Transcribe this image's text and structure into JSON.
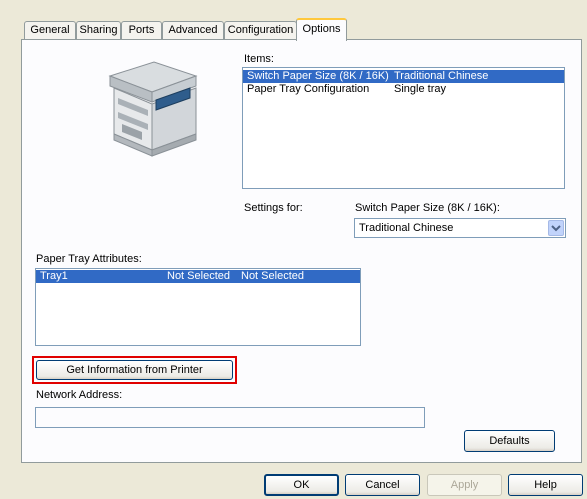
{
  "tabs": [
    "General",
    "Sharing",
    "Ports",
    "Advanced",
    "Configuration",
    "Options"
  ],
  "active_tab": "Options",
  "items": {
    "label": "Items:",
    "rows": [
      {
        "name": "Switch Paper Size (8K / 16K)",
        "value": "Traditional Chinese",
        "selected": true
      },
      {
        "name": "Paper Tray Configuration",
        "value": "Single tray",
        "selected": false
      }
    ]
  },
  "settings_for": {
    "label": "Settings for:",
    "setting_name": "Switch Paper Size (8K / 16K):",
    "selected_value": "Traditional Chinese"
  },
  "paper_tray": {
    "label": "Paper Tray Attributes:",
    "rows": [
      {
        "name": "Tray1",
        "col1": "Not Selected",
        "col2": "Not Selected",
        "selected": true
      }
    ]
  },
  "get_info_button": "Get Information from Printer",
  "network_address": {
    "label": "Network Address:",
    "value": ""
  },
  "defaults_button": "Defaults",
  "footer": {
    "ok": "OK",
    "cancel": "Cancel",
    "apply": "Apply",
    "help": "Help"
  },
  "colors": {
    "selection": "#316ac5",
    "highlight_border": "#e00000",
    "tab_accent": "#ffc83c"
  },
  "printer_image": "printer-illustration"
}
